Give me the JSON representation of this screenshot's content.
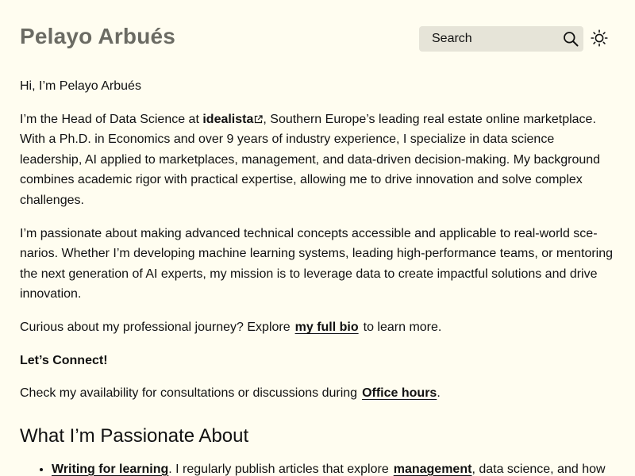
{
  "header": {
    "site_title": "Pelayo Arbués",
    "search_placeholder": "Search",
    "icons": {
      "search": "search-icon",
      "theme": "sun-icon"
    }
  },
  "intro": {
    "greeting": "Hi, I’m Pelayo Arbués",
    "p1_before": "I’m the Head of Data Science at ",
    "p1_link": "idealista",
    "p1_after": ", Southern Europe’s leading real estate online marketplace. With a Ph.D. in Economics and over 9 years of industry experience, I specialize in data science leadership, AI applied to marketplaces, management, and data-driven decision-making. My background combines academic rigor with practical expertise, allowing me to drive innovation and solve complex challenges.",
    "p2": "I’m passionate about making advanced technical concepts accessible and applicable to real-world sce­narios. Whether I’m developing machine learning systems, leading high-performance teams, or mentoring the next generation of AI experts, my mission is to leverage data to create impactful solutions and drive innovation.",
    "p3_before": "Curious about my professional journey? Explore",
    "p3_link": "my full bio",
    "p3_after": "to learn more.",
    "connect_heading": "Let’s Connect!",
    "p4_before": "Check my availability for consultations or discussions during",
    "p4_link": "Office hours",
    "p4_after": "."
  },
  "passion": {
    "heading": "What I’m Passionate About",
    "items": [
      {
        "link": "Writing for learning",
        "text_before": ". I regularly publish articles that explore",
        "link2": "management",
        "text_after": ", data science, and how AI can be applied to solve real-world challenges."
      }
    ]
  }
}
